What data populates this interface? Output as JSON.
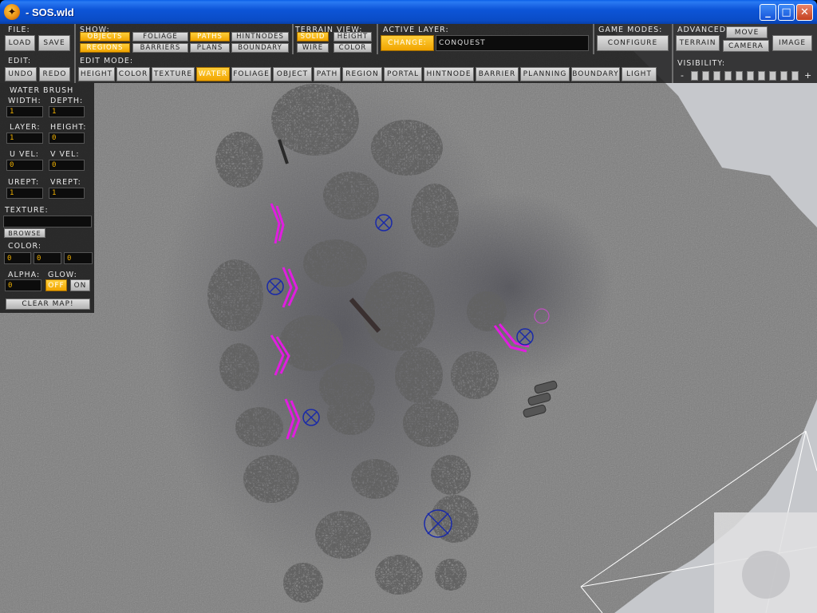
{
  "window": {
    "title": "- SOS.wld",
    "controls": {
      "minimize": "_",
      "maximize": "□",
      "close": "✕"
    }
  },
  "toolbar": {
    "file": {
      "label": "File:",
      "load": "Load",
      "save": "Save"
    },
    "show": {
      "label": "Show:",
      "items": [
        {
          "label": "Objects",
          "active": true
        },
        {
          "label": "Foliage",
          "active": false
        },
        {
          "label": "Paths",
          "active": true
        },
        {
          "label": "HintNodes",
          "active": false
        },
        {
          "label": "Regions",
          "active": true
        },
        {
          "label": "Barriers",
          "active": false
        },
        {
          "label": "Plans",
          "active": false
        },
        {
          "label": "Boundary",
          "active": false
        }
      ]
    },
    "terrain_view": {
      "label": "Terrain View:",
      "items": [
        {
          "label": "Solid",
          "active": true
        },
        {
          "label": "Height",
          "active": false
        },
        {
          "label": "Wire",
          "active": false
        },
        {
          "label": "Color",
          "active": false
        }
      ]
    },
    "active_layer": {
      "label": "Active Layer:",
      "change": "Change:",
      "value": "conquest"
    },
    "game_modes": {
      "label": "Game Modes:",
      "configure": "Configure"
    },
    "advanced": {
      "label": "Advanced",
      "terrain": "Terrain",
      "move": "Move",
      "camera": "Camera",
      "image": "Image"
    },
    "edit": {
      "label": "Edit:",
      "undo": "Undo",
      "redo": "Redo"
    },
    "edit_mode": {
      "label": "Edit Mode:",
      "items": [
        {
          "label": "Height",
          "active": false
        },
        {
          "label": "Color",
          "active": false
        },
        {
          "label": "Texture",
          "active": false
        },
        {
          "label": "Water",
          "active": true
        },
        {
          "label": "Foliage",
          "active": false
        },
        {
          "label": "Object",
          "active": false
        },
        {
          "label": "Path",
          "active": false
        },
        {
          "label": "Region",
          "active": false
        },
        {
          "label": "Portal",
          "active": false
        },
        {
          "label": "HintNode",
          "active": false
        },
        {
          "label": "Barrier",
          "active": false
        },
        {
          "label": "Planning",
          "active": false
        },
        {
          "label": "Boundary",
          "active": false
        },
        {
          "label": "Light",
          "active": false
        }
      ]
    },
    "visibility": {
      "label": "Visibility:",
      "minus": "-",
      "plus": "+",
      "boxes": 10
    }
  },
  "water_brush": {
    "title": "Water Brush",
    "width_label": "Width:",
    "width": "1",
    "depth_label": "Depth:",
    "depth": "1",
    "layer_label": "Layer:",
    "layer": "1",
    "height_label": "Height:",
    "height": "0",
    "uvel_label": "U Vel:",
    "uvel": "0",
    "vvel_label": "V Vel:",
    "vvel": "0",
    "urept_label": "URept:",
    "urept": "1",
    "vrept_label": "VRept:",
    "vrept": "1",
    "texture_label": "Texture:",
    "texture": "",
    "browse": "Browse",
    "color_label": "Color:",
    "color": [
      "0",
      "0",
      "0"
    ],
    "alpha_label": "Alpha:",
    "alpha": "0",
    "glow_label": "Glow:",
    "glow_off": "Off",
    "glow_on": "On",
    "glow_active": "off",
    "clear_map": "Clear Map!"
  },
  "colors": {
    "accent": "#f0a400",
    "terrain": "#7a7a7a",
    "background": "#c6c8cc",
    "path_marker": "#e01ee0",
    "node_marker": "#1a2aa8"
  }
}
